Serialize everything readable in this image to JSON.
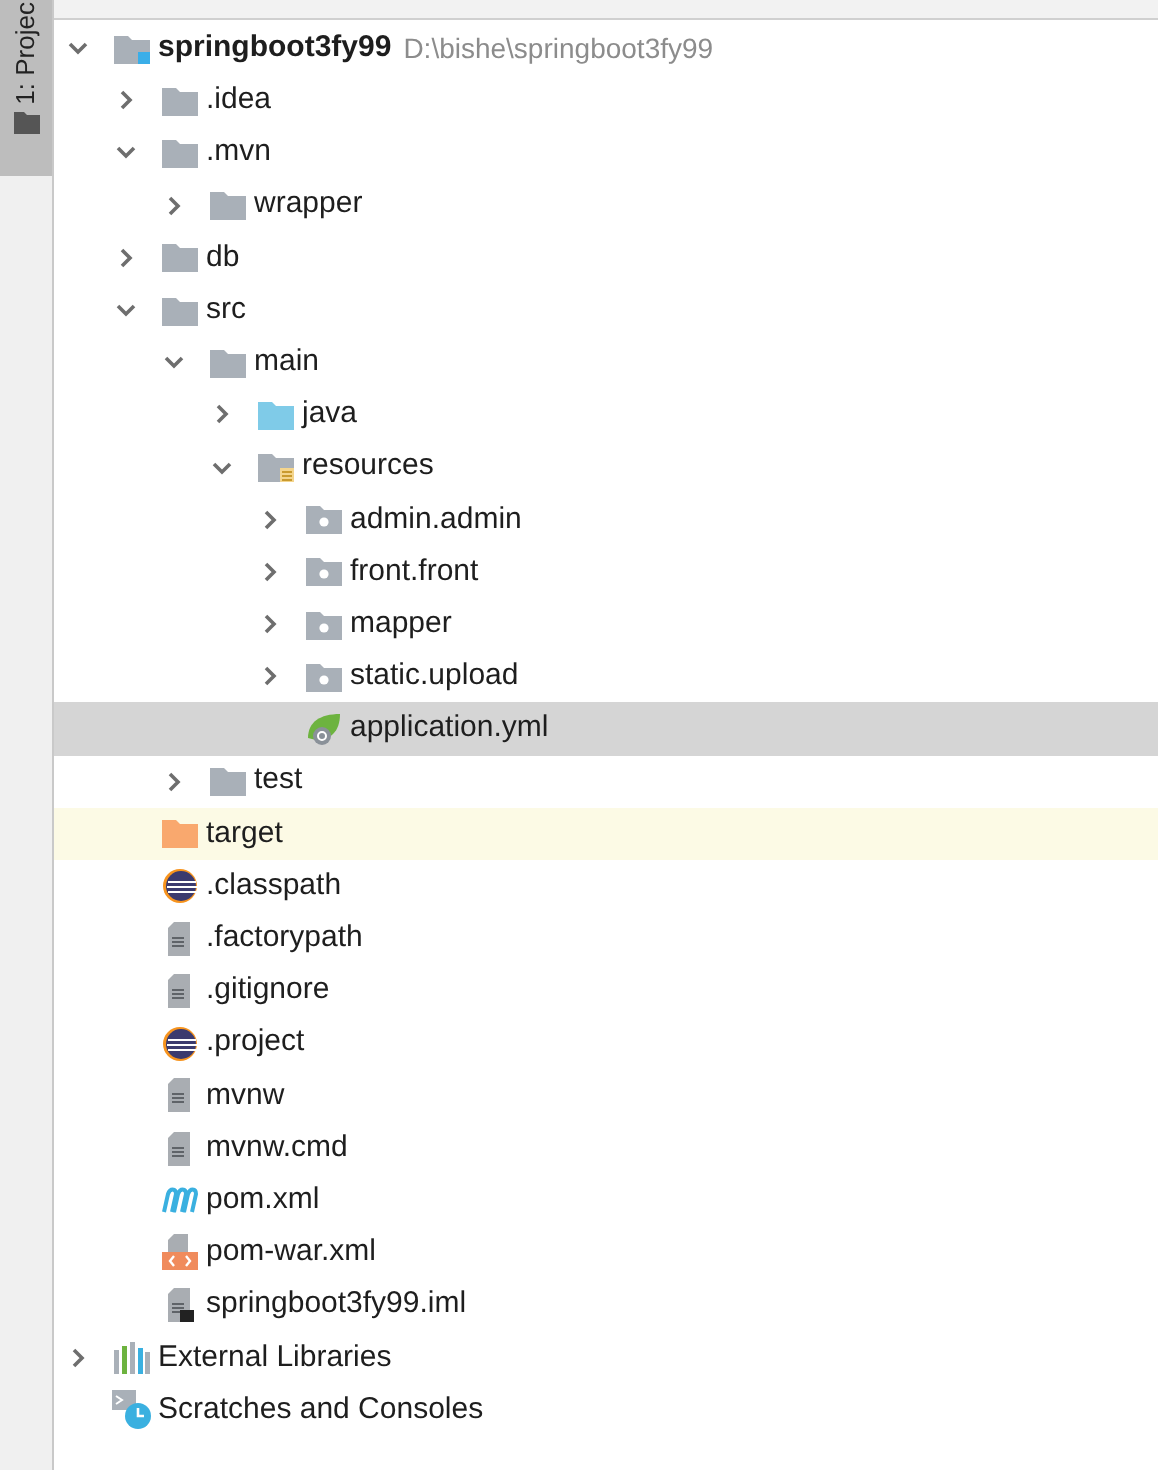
{
  "side_strip": {
    "label": "1: Projec"
  },
  "tree": [
    {
      "label": "springboot3fy99",
      "path": "D:\\bishe\\springboot3fy99",
      "kind": "module",
      "expanded": true,
      "selected": false,
      "children": [
        {
          "label": ".idea",
          "kind": "folder",
          "expanded": false,
          "selected": false
        },
        {
          "label": ".mvn",
          "kind": "folder",
          "expanded": true,
          "selected": false,
          "children": [
            {
              "label": "wrapper",
              "kind": "folder",
              "expanded": false,
              "selected": false
            }
          ]
        },
        {
          "label": "db",
          "kind": "folder",
          "expanded": false,
          "selected": false
        },
        {
          "label": "src",
          "kind": "folder",
          "expanded": true,
          "selected": false,
          "children": [
            {
              "label": "main",
              "kind": "folder",
              "expanded": true,
              "selected": false,
              "children": [
                {
                  "label": "java",
                  "kind": "source-folder",
                  "expanded": false,
                  "selected": false
                },
                {
                  "label": "resources",
                  "kind": "resources-folder",
                  "expanded": true,
                  "selected": false,
                  "children": [
                    {
                      "label": "admin.admin",
                      "kind": "package",
                      "expanded": false,
                      "selected": false
                    },
                    {
                      "label": "front.front",
                      "kind": "package",
                      "expanded": false,
                      "selected": false
                    },
                    {
                      "label": "mapper",
                      "kind": "package",
                      "expanded": false,
                      "selected": false
                    },
                    {
                      "label": "static.upload",
                      "kind": "package",
                      "expanded": false,
                      "selected": false
                    },
                    {
                      "label": "application.yml",
                      "kind": "spring-config",
                      "selected": true
                    }
                  ]
                }
              ]
            },
            {
              "label": "test",
              "kind": "folder",
              "expanded": false,
              "selected": false
            }
          ]
        },
        {
          "label": "target",
          "kind": "excluded-folder",
          "selected": false
        },
        {
          "label": ".classpath",
          "kind": "eclipse",
          "selected": false
        },
        {
          "label": ".factorypath",
          "kind": "text-file",
          "selected": false
        },
        {
          "label": ".gitignore",
          "kind": "text-file",
          "selected": false
        },
        {
          "label": ".project",
          "kind": "eclipse",
          "selected": false
        },
        {
          "label": "mvnw",
          "kind": "text-file",
          "selected": false
        },
        {
          "label": "mvnw.cmd",
          "kind": "text-file",
          "selected": false
        },
        {
          "label": "pom.xml",
          "kind": "maven",
          "selected": false
        },
        {
          "label": "pom-war.xml",
          "kind": "xml",
          "selected": false
        },
        {
          "label": "springboot3fy99.iml",
          "kind": "iml",
          "selected": false
        }
      ]
    },
    {
      "label": "External Libraries",
      "kind": "libraries",
      "expanded": false,
      "selected": false
    },
    {
      "label": "Scratches and Consoles",
      "kind": "scratches",
      "selected": false
    }
  ]
}
